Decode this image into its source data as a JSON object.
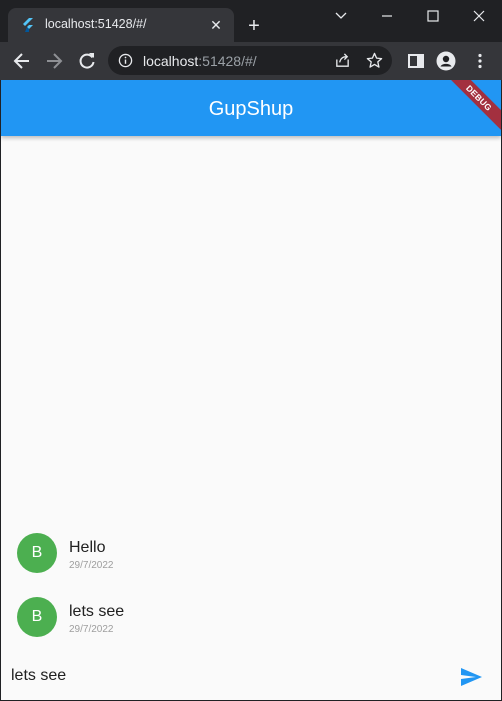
{
  "browser": {
    "tab_title": "localhost:51428/#/",
    "url_host": "localhost",
    "url_rest": ":51428/#/"
  },
  "app": {
    "title": "GupShup",
    "debug_banner": "DEBUG",
    "primary_color": "#2196f3",
    "avatar_color": "#4caf50"
  },
  "messages": [
    {
      "avatar": "B",
      "text": "Hello",
      "date": "29/7/2022"
    },
    {
      "avatar": "B",
      "text": "lets see",
      "date": "29/7/2022"
    }
  ],
  "composer": {
    "value": "lets see",
    "send_icon": "send-icon"
  }
}
